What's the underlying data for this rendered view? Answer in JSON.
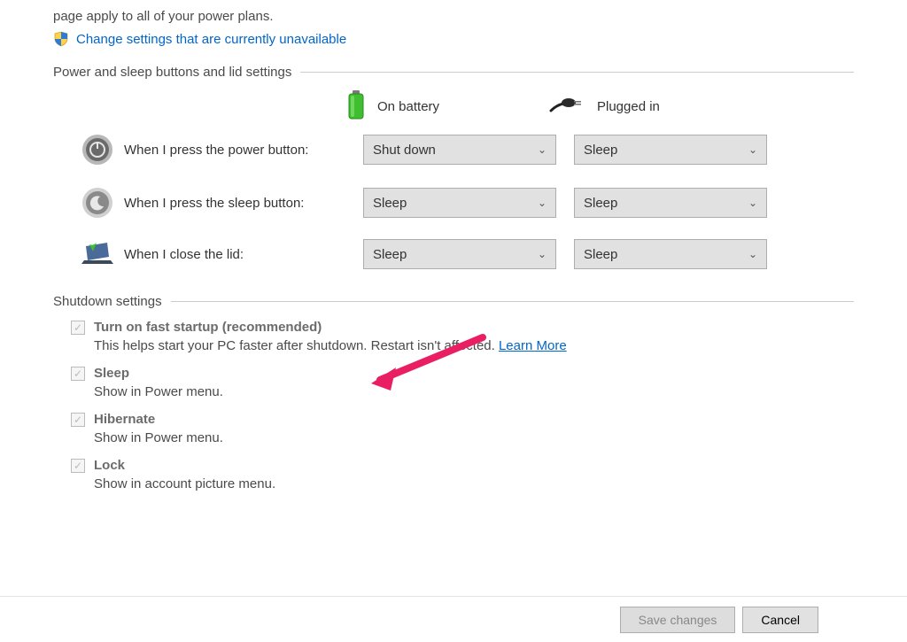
{
  "intro": "page apply to all of your power plans.",
  "change_link": "Change settings that are currently unavailable",
  "section_buttons": "Power and sleep buttons and lid settings",
  "col_battery": "On battery",
  "col_plugged": "Plugged in",
  "rows": {
    "power": {
      "label": "When I press the power button:",
      "battery": "Shut down",
      "plugged": "Sleep"
    },
    "sleep": {
      "label": "When I press the sleep button:",
      "battery": "Sleep",
      "plugged": "Sleep"
    },
    "lid": {
      "label": "When I close the lid:",
      "battery": "Sleep",
      "plugged": "Sleep"
    }
  },
  "section_shutdown": "Shutdown settings",
  "shutdown": {
    "fast": {
      "title": "Turn on fast startup (recommended)",
      "desc": "This helps start your PC faster after shutdown. Restart isn't affected.",
      "learn": "Learn More"
    },
    "sleep": {
      "title": "Sleep",
      "desc": "Show in Power menu."
    },
    "hibernate": {
      "title": "Hibernate",
      "desc": "Show in Power menu."
    },
    "lock": {
      "title": "Lock",
      "desc": "Show in account picture menu."
    }
  },
  "footer": {
    "save": "Save changes",
    "cancel": "Cancel"
  }
}
